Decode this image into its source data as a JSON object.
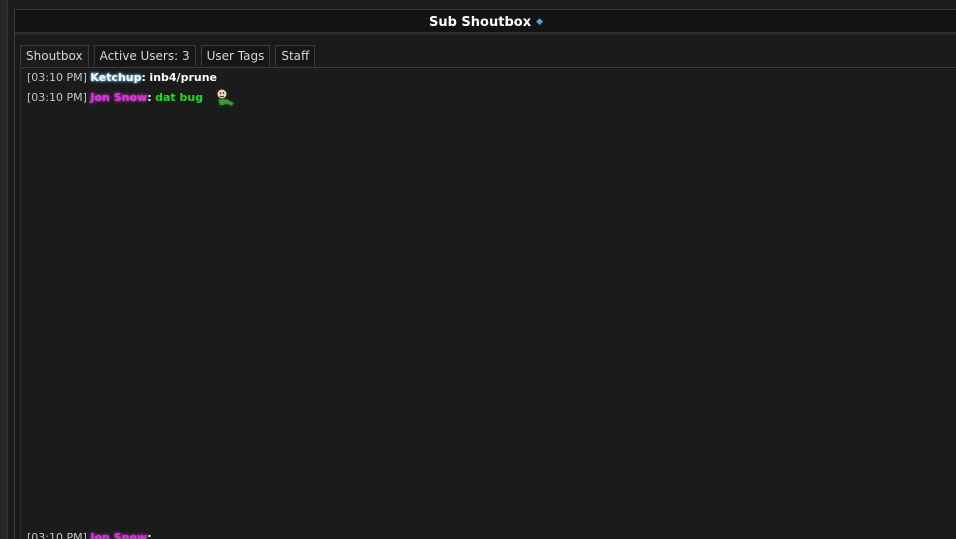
{
  "window": {
    "title": "Sub Shoutbox",
    "title_icon": "diamond-icon",
    "accent": "#4aa3df"
  },
  "tabs": [
    {
      "label": "Shoutbox"
    },
    {
      "label": "Active Users: 3"
    },
    {
      "label": "User Tags"
    },
    {
      "label": "Staff"
    }
  ],
  "messages": [
    {
      "timestamp": "[03:10 PM]",
      "user": "Ketchup",
      "user_color": "#ffffff",
      "separator": ":",
      "text": "inb4/prune",
      "text_color": "#ffffff"
    },
    {
      "timestamp": "[03:10 PM]",
      "user": "Jon Snow",
      "user_color": "#e233e2",
      "separator": ":",
      "text": "dat bug",
      "text_color": "#22dd22",
      "emote": "cartoon-character-emote-icon"
    },
    {
      "timestamp": "[03:10 PM]",
      "user": "Jon Snow",
      "user_color": "#e233e2",
      "separator": ":",
      "text": ""
    }
  ]
}
